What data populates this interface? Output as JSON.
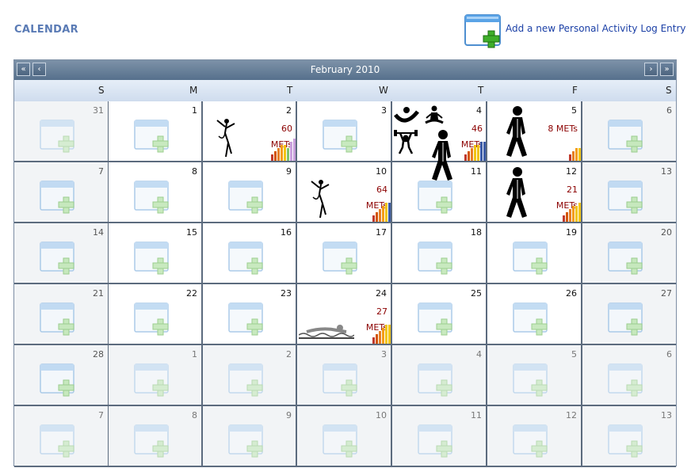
{
  "page": {
    "title": "CALENDAR",
    "add_entry_label": "Add a new Personal Activity Log Entry"
  },
  "nav": {
    "month_label": "February 2010",
    "prev_year": "«",
    "prev_month": "‹",
    "next_month": "›",
    "next_year": "»"
  },
  "weekdays": [
    "S",
    "M",
    "T",
    "W",
    "T",
    "F",
    "S"
  ],
  "weeks": [
    [
      {
        "day": "31",
        "other": true
      },
      {
        "day": "1"
      },
      {
        "day": "2",
        "value": "60",
        "unit": "METs",
        "icons": [
          "dancer-icon"
        ]
      },
      {
        "day": "3"
      },
      {
        "day": "4",
        "value": "46",
        "unit": "METs",
        "icons": [
          "gymnastics-icon",
          "yoga-icon",
          "weightlifting-icon",
          "walking-icon"
        ]
      },
      {
        "day": "5",
        "value": "8 METs",
        "unit": "",
        "icons": [
          "walking-icon"
        ]
      },
      {
        "day": "6"
      }
    ],
    [
      {
        "day": "7"
      },
      {
        "day": "8"
      },
      {
        "day": "9"
      },
      {
        "day": "10",
        "value": "64",
        "unit": "METs",
        "icons": [
          "dancer-icon"
        ]
      },
      {
        "day": "11"
      },
      {
        "day": "12",
        "value": "21",
        "unit": "METs",
        "icons": [
          "walking-icon"
        ]
      },
      {
        "day": "13"
      }
    ],
    [
      {
        "day": "14"
      },
      {
        "day": "15"
      },
      {
        "day": "16"
      },
      {
        "day": "17"
      },
      {
        "day": "18"
      },
      {
        "day": "19"
      },
      {
        "day": "20"
      }
    ],
    [
      {
        "day": "21"
      },
      {
        "day": "22"
      },
      {
        "day": "23"
      },
      {
        "day": "24",
        "value": "27",
        "unit": "METs",
        "icons": [
          "swimming-icon"
        ]
      },
      {
        "day": "25"
      },
      {
        "day": "26"
      },
      {
        "day": "27"
      }
    ],
    [
      {
        "day": "28"
      },
      {
        "day": "1",
        "other": true
      },
      {
        "day": "2",
        "other": true
      },
      {
        "day": "3",
        "other": true
      },
      {
        "day": "4",
        "other": true
      },
      {
        "day": "5",
        "other": true
      },
      {
        "day": "6",
        "other": true
      }
    ],
    [
      {
        "day": "7",
        "other": true
      },
      {
        "day": "8",
        "other": true
      },
      {
        "day": "9",
        "other": true
      },
      {
        "day": "10",
        "other": true
      },
      {
        "day": "11",
        "other": true
      },
      {
        "day": "12",
        "other": true
      },
      {
        "day": "13",
        "other": true
      }
    ]
  ],
  "week_bars": [
    {
      "week": 0,
      "col": 2,
      "levels": [
        2,
        3,
        4,
        5,
        5,
        4,
        6,
        7
      ],
      "colors": [
        "#c0392b",
        "#d35400",
        "#e67e22",
        "#f39c12",
        "#f1c40f",
        "#7dc36b",
        "#c9a0dc",
        "#c9a0dc"
      ]
    },
    {
      "week": 0,
      "col": 4,
      "levels": [
        2,
        3,
        4,
        5,
        5,
        6,
        6
      ],
      "colors": [
        "#c0392b",
        "#d35400",
        "#e67e22",
        "#f1c40f",
        "#f1c40f",
        "#3b5ba5",
        "#3b5ba5"
      ]
    },
    {
      "week": 0,
      "col": 5,
      "levels": [
        2,
        3,
        4,
        4
      ],
      "colors": [
        "#c0392b",
        "#e67e22",
        "#f39c12",
        "#f1c40f"
      ]
    },
    {
      "week": 1,
      "col": 3,
      "levels": [
        2,
        3,
        4,
        5,
        6,
        6
      ],
      "colors": [
        "#c0392b",
        "#d35400",
        "#e67e22",
        "#f39c12",
        "#f1c40f",
        "#3b5ba5"
      ]
    },
    {
      "week": 1,
      "col": 5,
      "levels": [
        2,
        3,
        4,
        5,
        5,
        6
      ],
      "colors": [
        "#c0392b",
        "#d35400",
        "#e67e22",
        "#f39c12",
        "#f1c40f",
        "#f1c40f"
      ]
    },
    {
      "week": 3,
      "col": 3,
      "levels": [
        2,
        3,
        4,
        5,
        6,
        6
      ],
      "colors": [
        "#c0392b",
        "#d35400",
        "#e67e22",
        "#f39c12",
        "#f1c40f",
        "#f1c40f"
      ]
    }
  ]
}
